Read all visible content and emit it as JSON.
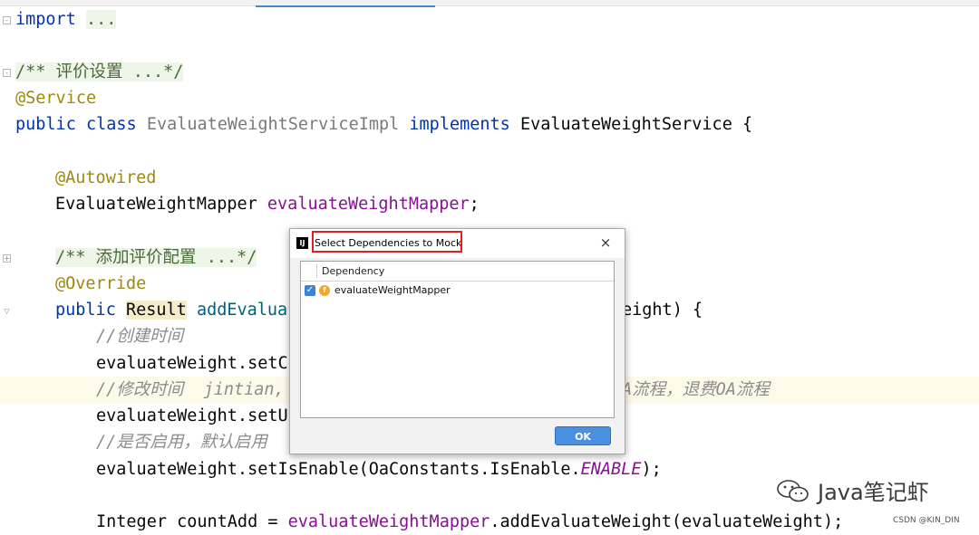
{
  "editor": {
    "lines": {
      "l1_kw": "import",
      "l1_dots": "...",
      "l3_doc": "/** 评价设置 ...*/",
      "l4_ann": "@Service",
      "l5_kw1": "public",
      "l5_kw2": "class",
      "l5_cls": "EvaluateWeightServiceImpl",
      "l5_kw3": "implements",
      "l5_iface": "EvaluateWeightService {",
      "l7_ann": "@Autowired",
      "l8_type": "EvaluateWeightMapper",
      "l8_field": "evaluateWeightMapper",
      "l8_end": ";",
      "l10_doc": "/** 添加评价配置 ...*/",
      "l11_ann": "@Override",
      "l12_kw": "public",
      "l12_res": "Result",
      "l12_method": "addEvalua",
      "l12_tail": "eight) {",
      "l13_cmt": "//创建时间",
      "l14_code": "evaluateWeight.setC",
      "l15_cmt": "//修改时间  jintian,",
      "l15_tail": "A流程，退费OA流程",
      "l16_code": "evaluateWeight.setU",
      "l17_cmt": "//是否启用，默认启用",
      "l18_pre": "evaluateWeight.setIsEnable(OaConstants.IsEnable.",
      "l18_const": "ENABLE",
      "l18_end": ");",
      "l20_pre": "Integer countAdd = ",
      "l20_field": "evaluateWeightMapper",
      "l20_end": ".addEvaluateWeight(evaluateWeight);"
    }
  },
  "dialog": {
    "title": "Select Dependencies to Mock",
    "close_icon": "×",
    "column_header": "Dependency",
    "items": [
      {
        "label": "evaluateWeightMapper",
        "checked": true,
        "icon": "f"
      }
    ],
    "ok_label": "OK"
  },
  "watermark": {
    "text": "Java笔记虾",
    "source": "CSDN @KIN_DIN"
  }
}
